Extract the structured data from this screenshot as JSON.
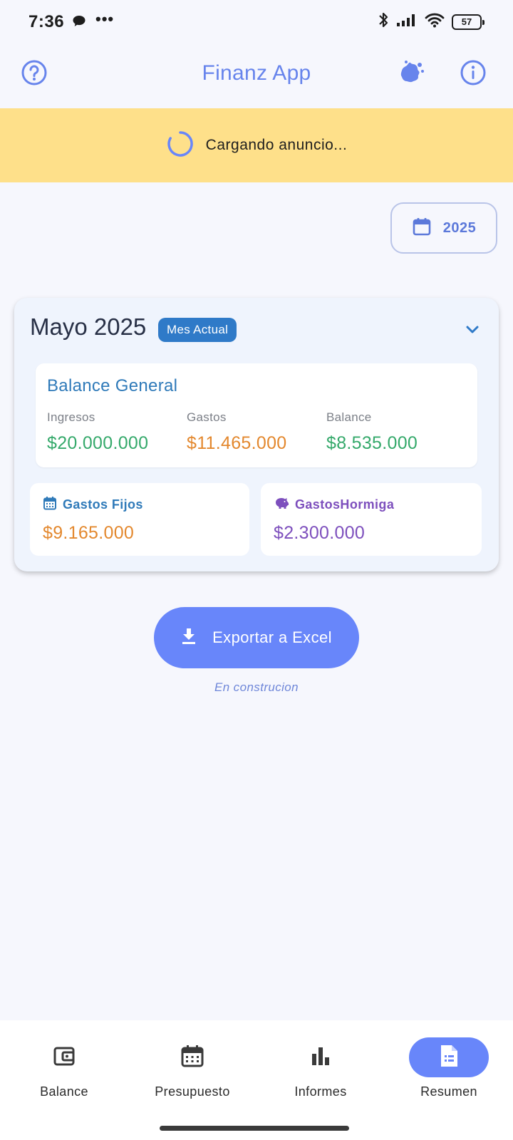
{
  "status_bar": {
    "time": "7:36",
    "battery": "57",
    "icons": [
      "chat-bubble-icon",
      "more-dots-icon",
      "bluetooth-icon",
      "signal-icon",
      "wifi-icon",
      "battery-icon"
    ]
  },
  "app_bar": {
    "title": "Finanz App",
    "title_color": "#6784ec",
    "icons": [
      "help-icon",
      "paint-splash-icon",
      "info-icon"
    ]
  },
  "ad_banner": {
    "text": "Cargando anuncio...",
    "background": "#fee08a"
  },
  "year_selector": {
    "value": "2025"
  },
  "month_card": {
    "title": "Mayo 2025",
    "badge": "Mes Actual",
    "balance_general": {
      "title": "Balance General",
      "income_label": "Ingresos",
      "income_value": "$20.000.000",
      "expenses_label": "Gastos",
      "expenses_value": "$11.465.000",
      "balance_label": "Balance",
      "balance_value": "$8.535.000"
    },
    "gastos_fijos": {
      "label": "Gastos Fijos",
      "value": "$9.165.000"
    },
    "gastos_hormiga": {
      "label": "GastosHormiga",
      "value": "$2.300.000"
    }
  },
  "export": {
    "label": "Exportar a Excel",
    "note": "En construcion"
  },
  "bottom_nav": {
    "items": [
      {
        "label": "Balance",
        "icon": "wallet-icon"
      },
      {
        "label": "Presupuesto",
        "icon": "calendar-grid-icon"
      },
      {
        "label": "Informes",
        "icon": "bar-chart-icon"
      },
      {
        "label": "Resumen",
        "icon": "document-icon",
        "active": true
      }
    ]
  },
  "colors": {
    "accent": "#6886fa",
    "positive": "#35a96b",
    "expense": "#e3882e",
    "hormiga": "#7d4fbd",
    "heading": "#2f7ab9"
  }
}
